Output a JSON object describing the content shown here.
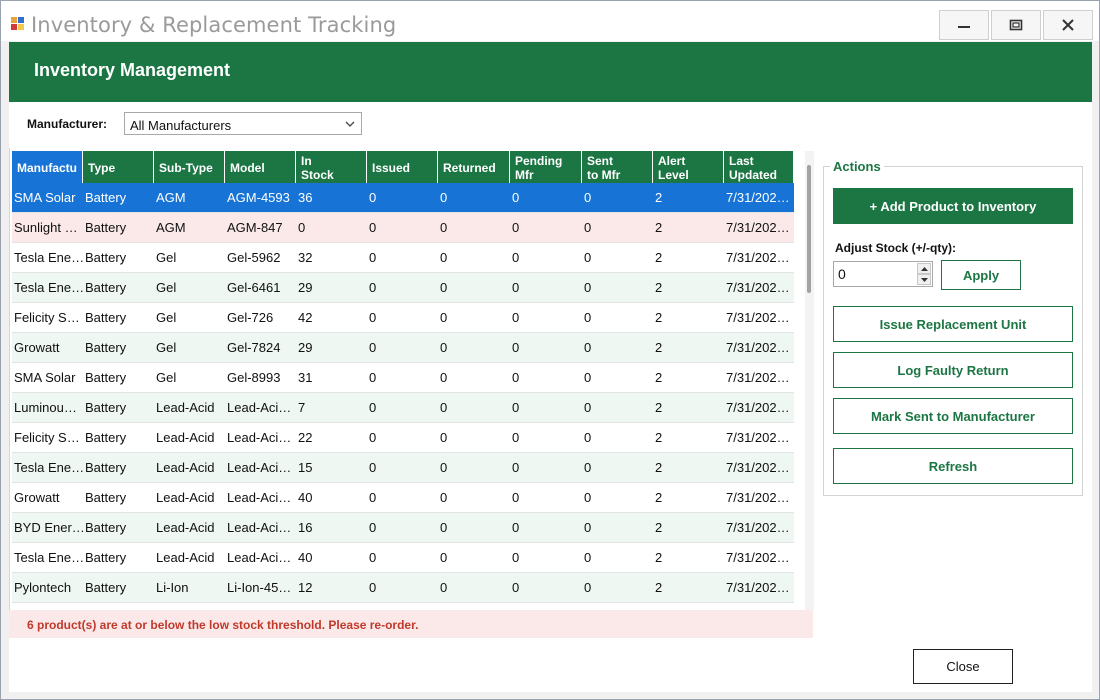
{
  "window": {
    "title": "Inventory & Replacement Tracking",
    "icon": "app-icon",
    "controls": [
      "minimize-icon",
      "maximize-icon",
      "close-icon"
    ]
  },
  "banner": {
    "title": "Inventory Management"
  },
  "filter": {
    "label": "Manufacturer:",
    "selected": "All Manufacturers"
  },
  "colors": {
    "accent": "#1c7644",
    "selection": "#1774d6",
    "low_stock_row": "#fbe9e9",
    "alt_row": "#eef7f1",
    "warning_text": "#c0392b"
  },
  "grid": {
    "columns": [
      {
        "label": "Manufactu",
        "line2": ""
      },
      {
        "label": "Type",
        "line2": ""
      },
      {
        "label": "Sub-Type",
        "line2": ""
      },
      {
        "label": "Model",
        "line2": ""
      },
      {
        "label": "In",
        "line2": "Stock"
      },
      {
        "label": "Issued",
        "line2": ""
      },
      {
        "label": "Returned",
        "line2": ""
      },
      {
        "label": "Pending",
        "line2": "Mfr"
      },
      {
        "label": "Sent",
        "line2": "to Mfr"
      },
      {
        "label": "Alert",
        "line2": "Level"
      },
      {
        "label": "Last",
        "line2": "Updated"
      }
    ],
    "rows": [
      {
        "state": "selected",
        "cells": [
          "SMA Solar",
          "Battery",
          "AGM",
          "AGM-4593",
          "36",
          "0",
          "0",
          "0",
          "0",
          "2",
          "7/31/202…"
        ]
      },
      {
        "state": "low",
        "cells": [
          "Sunlight …",
          "Battery",
          "AGM",
          "AGM-847",
          "0",
          "0",
          "0",
          "0",
          "0",
          "2",
          "7/31/202…"
        ]
      },
      {
        "state": "even",
        "cells": [
          "Tesla Ene…",
          "Battery",
          "Gel",
          "Gel-5962",
          "32",
          "0",
          "0",
          "0",
          "0",
          "2",
          "7/31/202…"
        ]
      },
      {
        "state": "odd",
        "cells": [
          "Tesla Ene…",
          "Battery",
          "Gel",
          "Gel-6461",
          "29",
          "0",
          "0",
          "0",
          "0",
          "2",
          "7/31/202…"
        ]
      },
      {
        "state": "even",
        "cells": [
          "Felicity S…",
          "Battery",
          "Gel",
          "Gel-726",
          "42",
          "0",
          "0",
          "0",
          "0",
          "2",
          "7/31/202…"
        ]
      },
      {
        "state": "odd",
        "cells": [
          "Growatt",
          "Battery",
          "Gel",
          "Gel-7824",
          "29",
          "0",
          "0",
          "0",
          "0",
          "2",
          "7/31/202…"
        ]
      },
      {
        "state": "even",
        "cells": [
          "SMA Solar",
          "Battery",
          "Gel",
          "Gel-8993",
          "31",
          "0",
          "0",
          "0",
          "0",
          "2",
          "7/31/202…"
        ]
      },
      {
        "state": "odd",
        "cells": [
          "Luminou…",
          "Battery",
          "Lead-Acid",
          "Lead-Aci…",
          "7",
          "0",
          "0",
          "0",
          "0",
          "2",
          "7/31/202…"
        ]
      },
      {
        "state": "even",
        "cells": [
          "Felicity S…",
          "Battery",
          "Lead-Acid",
          "Lead-Aci…",
          "22",
          "0",
          "0",
          "0",
          "0",
          "2",
          "7/31/202…"
        ]
      },
      {
        "state": "odd",
        "cells": [
          "Tesla Ene…",
          "Battery",
          "Lead-Acid",
          "Lead-Aci…",
          "15",
          "0",
          "0",
          "0",
          "0",
          "2",
          "7/31/202…"
        ]
      },
      {
        "state": "even",
        "cells": [
          "Growatt",
          "Battery",
          "Lead-Acid",
          "Lead-Aci…",
          "40",
          "0",
          "0",
          "0",
          "0",
          "2",
          "7/31/202…"
        ]
      },
      {
        "state": "odd",
        "cells": [
          "BYD Ener…",
          "Battery",
          "Lead-Acid",
          "Lead-Aci…",
          "16",
          "0",
          "0",
          "0",
          "0",
          "2",
          "7/31/202…"
        ]
      },
      {
        "state": "even",
        "cells": [
          "Tesla Ene…",
          "Battery",
          "Lead-Acid",
          "Lead-Aci…",
          "40",
          "0",
          "0",
          "0",
          "0",
          "2",
          "7/31/202…"
        ]
      },
      {
        "state": "odd",
        "cells": [
          "Pylontech",
          "Battery",
          "Li-Ion",
          "Li-Ion-45…",
          "12",
          "0",
          "0",
          "0",
          "0",
          "2",
          "7/31/202…"
        ]
      }
    ]
  },
  "warning": "6 product(s) are at or below the low stock threshold. Please re-order.",
  "actions": {
    "legend": "Actions",
    "add_label": "+ Add Product to Inventory",
    "adjust_label": "Adjust Stock (+/-qty):",
    "adjust_value": "0",
    "apply_label": "Apply",
    "issue_label": "Issue Replacement Unit",
    "faulty_label": "Log Faulty Return",
    "sent_label": "Mark Sent to Manufacturer",
    "refresh_label": "Refresh"
  },
  "footer": {
    "close_label": "Close"
  }
}
